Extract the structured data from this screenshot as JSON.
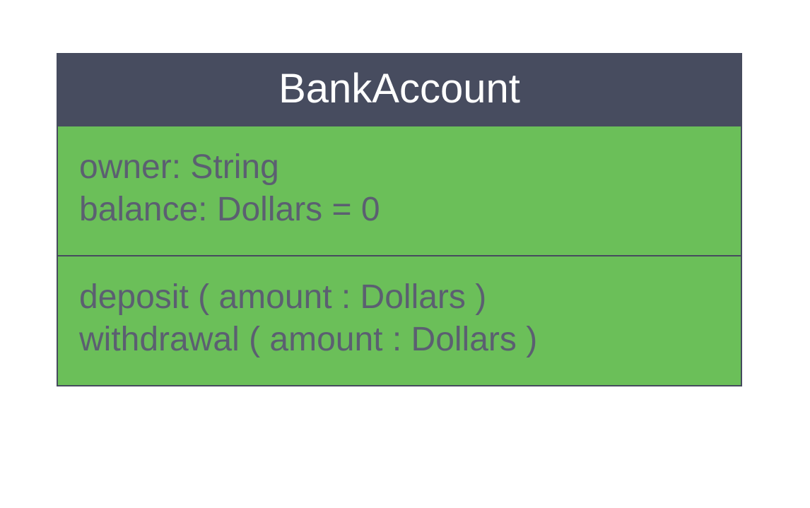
{
  "uml_class": {
    "name": "BankAccount",
    "attributes": [
      "owner: String",
      "balance: Dollars = 0"
    ],
    "operations": [
      "deposit ( amount : Dollars )",
      "withdrawal ( amount : Dollars )"
    ]
  },
  "colors": {
    "header_bg": "#474c5f",
    "header_text": "#ffffff",
    "body_bg": "#6bbf59",
    "body_text": "#5b5f71",
    "border": "#464b5e"
  }
}
